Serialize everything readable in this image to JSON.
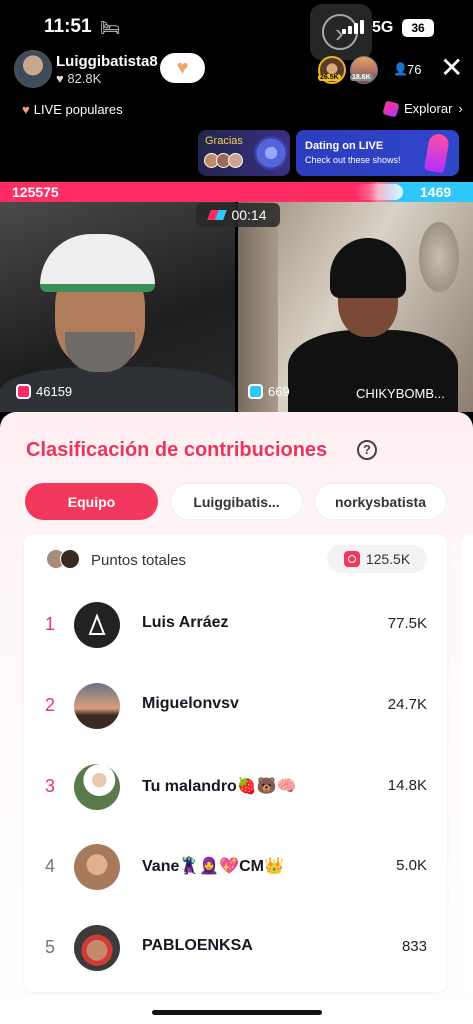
{
  "status_bar": {
    "time": "11:51",
    "sleep_icon": "bed-icon",
    "network": "5G",
    "battery": "36"
  },
  "host": {
    "name": "Luiggibatista8",
    "likes": "82.8K",
    "follow_badge": "9"
  },
  "viewers": {
    "badge1": "26.5K",
    "badge2": "18.6K",
    "count": "76"
  },
  "nav": {
    "live_popular": "LIVE populares",
    "explore": "Explorar"
  },
  "banners": {
    "gracias": "Gracias",
    "dating_title": "Dating on LIVE",
    "dating_subtitle": "Check out these shows!"
  },
  "battle": {
    "left_score": "125575",
    "right_score": "1469",
    "timer": "00:14",
    "left_points": "46159",
    "right_points": "669",
    "right_name": "CHIKYBOMB..."
  },
  "sheet": {
    "title": "Clasificación de contribuciones",
    "tabs": [
      "Equipo",
      "Luiggibatis...",
      "norkysbatista"
    ],
    "total_label": "Puntos totales",
    "total_value": "125.5K",
    "rows": [
      {
        "rank": "1",
        "name": "Luis Arráez",
        "score": "77.5K"
      },
      {
        "rank": "2",
        "name": "Miguelonvsv",
        "score": "24.7K"
      },
      {
        "rank": "3",
        "name": "Tu malandro🍓🐻🧠",
        "score": "14.8K"
      },
      {
        "rank": "4",
        "name": "Vane🦹‍♀️🧕💖CM👑",
        "score": "5.0K"
      },
      {
        "rank": "5",
        "name": "PABLOENKSA",
        "score": "833"
      }
    ]
  },
  "colors": {
    "accent": "#f2395d",
    "blue": "#2ec8ff",
    "title_red": "#e8365d"
  }
}
